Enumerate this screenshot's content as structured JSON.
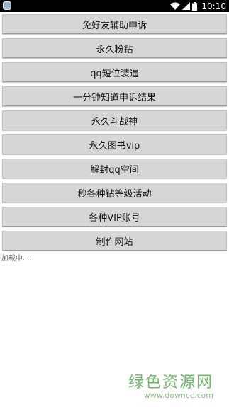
{
  "status_bar": {
    "time": "10:10",
    "icons": [
      "app-icon",
      "wifi-icon",
      "signal-icon",
      "battery-icon"
    ]
  },
  "menu": {
    "items": [
      {
        "label": "免好友辅助申诉"
      },
      {
        "label": "永久粉钻"
      },
      {
        "label": "qq短位装逼"
      },
      {
        "label": "一分钟知道申诉结果"
      },
      {
        "label": "永久斗战神"
      },
      {
        "label": "永久图书vip"
      },
      {
        "label": "解封qq空间"
      },
      {
        "label": "秒各种钻等级活动"
      },
      {
        "label": "各种VIP账号"
      },
      {
        "label": "制作网站"
      }
    ]
  },
  "loading_text": "加载中.....",
  "watermark": {
    "title": "绿色资源网",
    "url": "www.downcc.com"
  },
  "colors": {
    "button_bg": "#d6d6d6",
    "status_bar_bg": "#000000",
    "watermark_green": "#6fb96a"
  }
}
